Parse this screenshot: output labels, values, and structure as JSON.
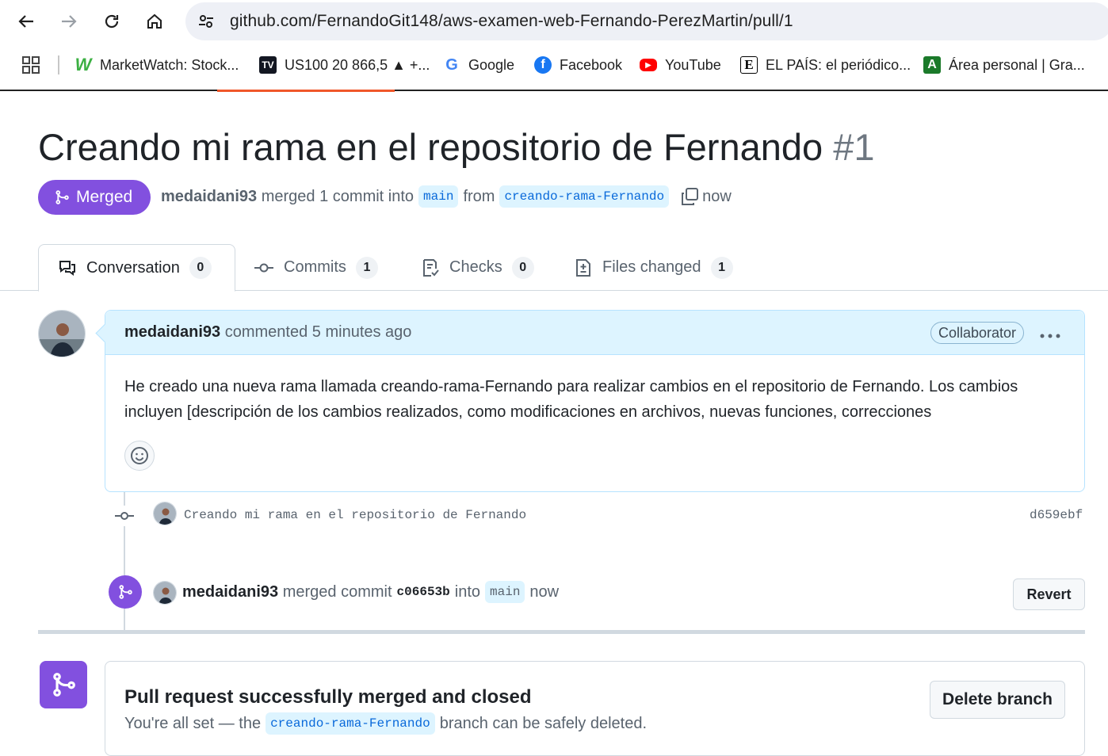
{
  "browser": {
    "url": "github.com/FernandoGit148/aws-examen-web-Fernando-PerezMartin/pull/1",
    "bookmarks": [
      {
        "label": "MarketWatch: Stock...",
        "icon": "marketwatch-icon"
      },
      {
        "label": "US100 20 866,5 ▲ +...",
        "icon": "tradingview-icon"
      },
      {
        "label": "Google",
        "icon": "google-icon"
      },
      {
        "label": "Facebook",
        "icon": "facebook-icon"
      },
      {
        "label": "YouTube",
        "icon": "youtube-icon"
      },
      {
        "label": "EL PAÍS: el periódico...",
        "icon": "elpais-icon"
      },
      {
        "label": "Área personal | Gra...",
        "icon": "aula-icon"
      }
    ]
  },
  "pr": {
    "title": "Creando mi rama en el repositorio de Fernando",
    "number": "#1",
    "state": "Merged",
    "author": "medaidani93",
    "merged_text": "merged 1 commit into",
    "base_branch": "main",
    "from_text": "from",
    "head_branch": "creando-rama-Fernando",
    "time": "now"
  },
  "tabs": [
    {
      "label": "Conversation",
      "count": "0",
      "icon": "comment-discussion-icon"
    },
    {
      "label": "Commits",
      "count": "1",
      "icon": "git-commit-icon"
    },
    {
      "label": "Checks",
      "count": "0",
      "icon": "checklist-icon"
    },
    {
      "label": "Files changed",
      "count": "1",
      "icon": "file-diff-icon"
    }
  ],
  "comment": {
    "author": "medaidani93",
    "when": "commented 5 minutes ago",
    "role": "Collaborator",
    "body": "He creado una nueva rama llamada creando-rama-Fernando para realizar cambios en el repositorio de Fernando. Los cambios incluyen [descripción de los cambios realizados, como modificaciones en archivos, nuevas funciones, correcciones"
  },
  "commit": {
    "message": "Creando mi rama en el repositorio de Fernando",
    "sha": "d659ebf"
  },
  "merge_event": {
    "author": "medaidani93",
    "text1": "merged commit",
    "sha": "c06653b",
    "text2": "into",
    "branch": "main",
    "time": "now",
    "revert_label": "Revert"
  },
  "merged_box": {
    "title": "Pull request successfully merged and closed",
    "sub_prefix": "You're all set — the",
    "branch": "creando-rama-Fernando",
    "sub_suffix": "branch can be safely deleted.",
    "delete_label": "Delete branch"
  },
  "colors": {
    "merged_purple": "#8250df",
    "link_blue": "#0969da",
    "branch_bg": "#ddf4ff"
  }
}
